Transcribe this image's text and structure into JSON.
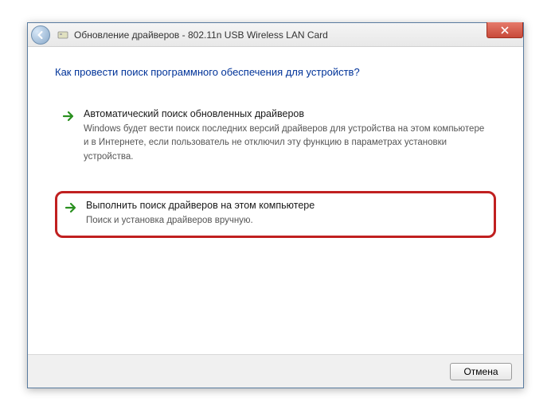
{
  "window": {
    "title_prefix": "Обновление драйверов",
    "title_device": "802.11n USB Wireless LAN Card"
  },
  "heading": "Как провести поиск программного обеспечения для устройств?",
  "options": [
    {
      "title": "Автоматический поиск обновленных драйверов",
      "desc": "Windows будет вести поиск последних версий драйверов для устройства на этом компьютере и в Интернете, если пользователь не отключил эту функцию в параметрах установки устройства."
    },
    {
      "title": "Выполнить поиск драйверов на этом компьютере",
      "desc": "Поиск и установка драйверов вручную."
    }
  ],
  "footer": {
    "cancel_label": "Отмена"
  }
}
